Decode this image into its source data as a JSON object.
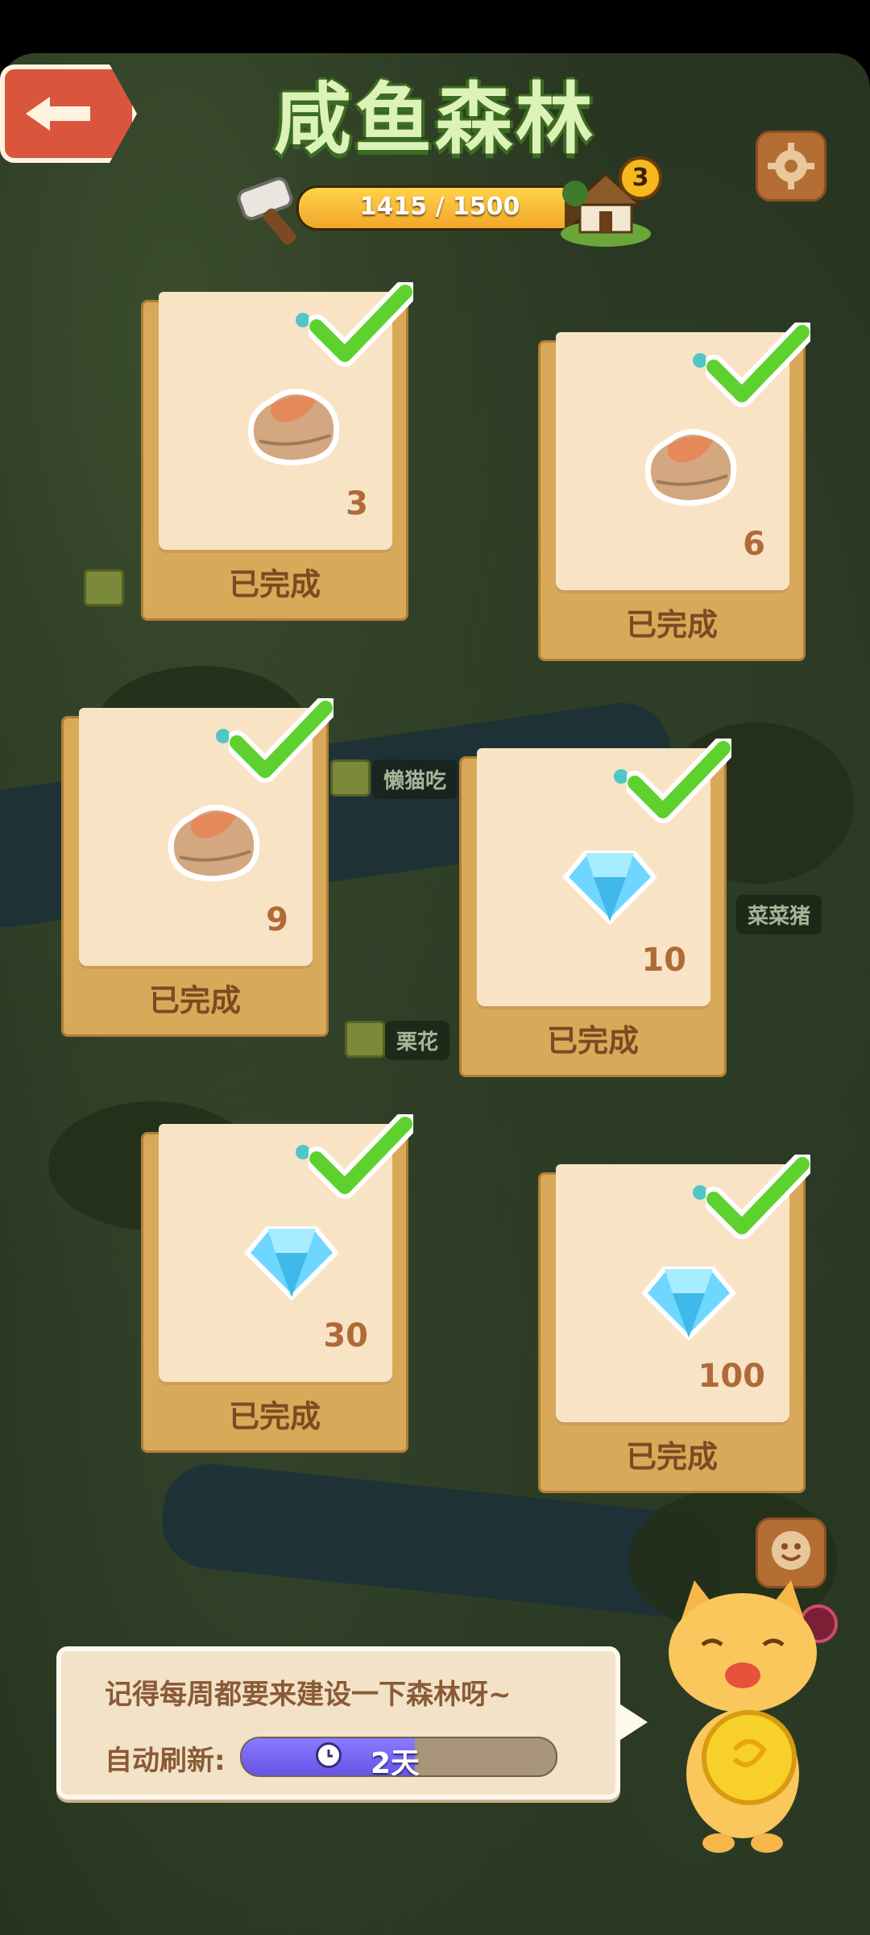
{
  "header": {
    "title": "咸鱼森林",
    "progress": {
      "current": 1415,
      "max": 1500,
      "text": "1415 / 1500"
    },
    "house_badge": "3"
  },
  "map_labels": [
    "懒猫吃",
    "菜菜猪",
    "栗花"
  ],
  "cards": [
    {
      "item": "ore-icon",
      "count": "3",
      "status": "已完成"
    },
    {
      "item": "ore-icon",
      "count": "6",
      "status": "已完成"
    },
    {
      "item": "ore-icon",
      "count": "9",
      "status": "已完成"
    },
    {
      "item": "diamond-icon",
      "count": "10",
      "status": "已完成"
    },
    {
      "item": "diamond-icon",
      "count": "30",
      "status": "已完成"
    },
    {
      "item": "diamond-icon",
      "count": "100",
      "status": "已完成"
    }
  ],
  "bubble": {
    "message": "记得每周都要来建设一下森林呀~",
    "refresh_label": "自动刷新:",
    "refresh_value": "2天",
    "refresh_progress": 0.55
  },
  "colors": {
    "title": "#dcf3b8",
    "progress_fill": "#ffd24a",
    "check": "#5ed12e",
    "refresh_fill": "#6554e6"
  }
}
